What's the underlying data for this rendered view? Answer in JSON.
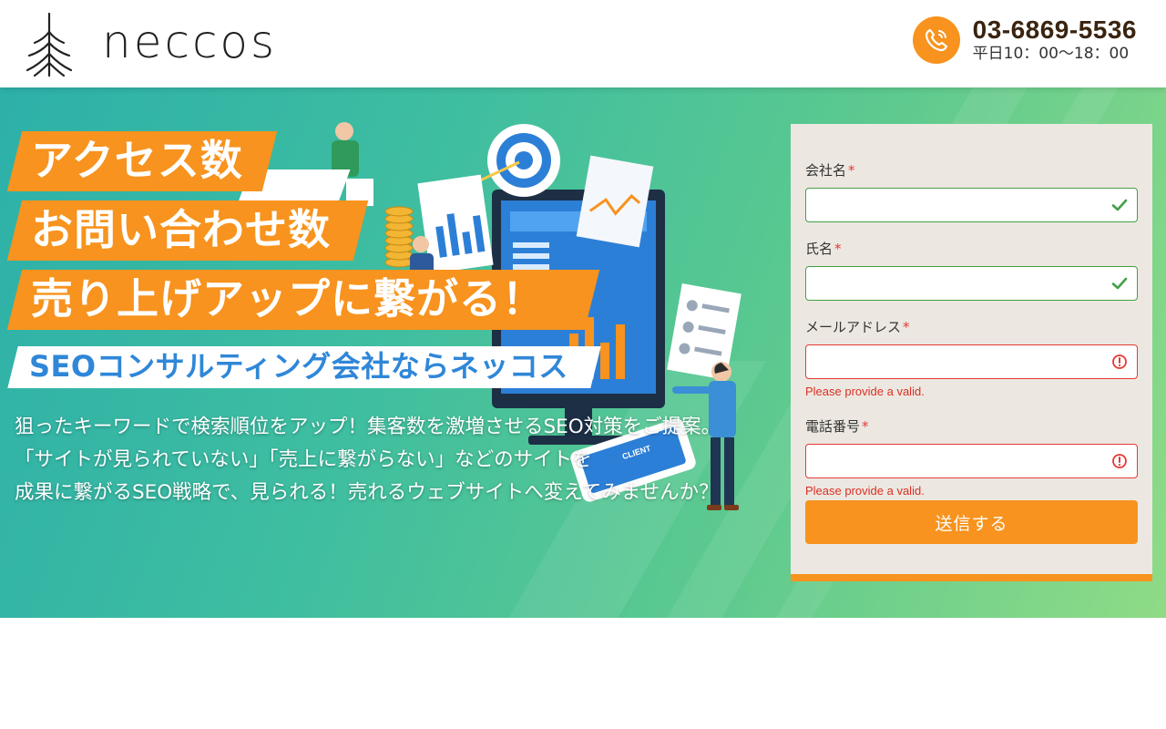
{
  "header": {
    "logo_text": "neccos",
    "phone": "03-6869-5536",
    "hours": "平日10：00〜18：00"
  },
  "hero": {
    "catch_lines": [
      "アクセス数",
      "お問い合わせ数",
      "売り上げアップに繋がる！"
    ],
    "subtitle": "SEOコンサルティング会社ならネッコス",
    "description_lines": [
      "狙ったキーワードで検索順位をアップ！集客数を激増させるSEO対策をご提案。",
      "「サイトが見られていない」「売上に繋がらない」などのサイトを",
      "成果に繋がるSEO戦略で、見られる！売れるウェブサイトへ変えてみませんか？"
    ],
    "illustration_text": "CLIENT"
  },
  "form": {
    "fields": [
      {
        "label": "会社名",
        "required": "*",
        "value": "",
        "state": "valid",
        "error": ""
      },
      {
        "label": "氏名",
        "required": "*",
        "value": "",
        "state": "valid",
        "error": ""
      },
      {
        "label": "メールアドレス",
        "required": "*",
        "value": "",
        "state": "invalid",
        "error": "Please provide a valid."
      },
      {
        "label": "電話番号",
        "required": "*",
        "value": "",
        "state": "invalid",
        "error": "Please provide a valid."
      }
    ],
    "submit_label": "送信する"
  },
  "colors": {
    "accent_orange": "#f7931e",
    "subtitle_blue": "#2f87d8",
    "valid_green": "#43a047",
    "invalid_red": "#e53935",
    "phone_text": "#3a2410"
  },
  "icons": [
    "logo-tree-icon",
    "phone-icon",
    "check-icon",
    "alert-circle-icon"
  ]
}
